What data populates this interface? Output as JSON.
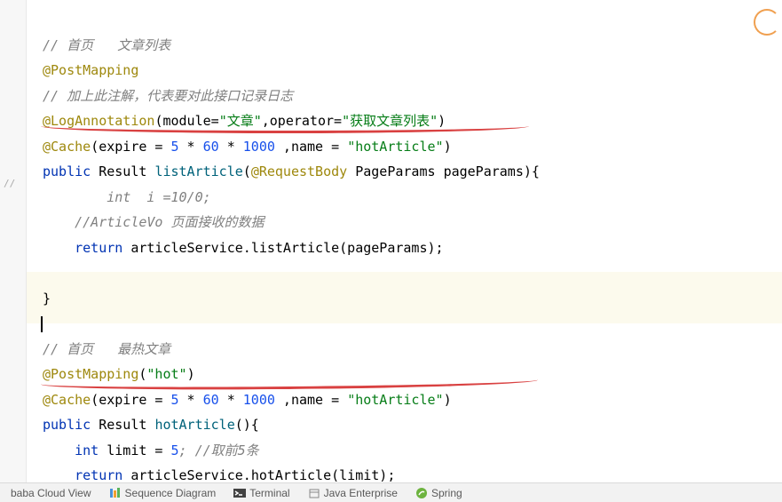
{
  "code": {
    "l1_comment": "// 首页   文章列表",
    "l2_anno": "@PostMapping",
    "l3_comment": "// 加上此注解，代表要对此接口记录日志",
    "l4_anno": "@LogAnnotation",
    "l4_module_key": "module=",
    "l4_module_val": "\"文章\"",
    "l4_op_key": "operator=",
    "l4_op_val": "\"获取文章列表\"",
    "l5_anno": "@Cache",
    "l5_exp_key": "expire = ",
    "l5_n1": "5",
    "l5_n2": "60",
    "l5_n3": "1000",
    "l5_name_key": " ,name = ",
    "l5_name_val": "\"hotArticle\"",
    "l6_kw1": "public",
    "l6_type": "Result",
    "l6_method": "listArticle",
    "l6_anno": "@RequestBody",
    "l6_ptype": "PageParams",
    "l6_pname": "pageParams",
    "l7_comment": "        int  i =10/0;",
    "l8_comment": "    //ArticleVo 页面接收的数据",
    "l9_kw": "return",
    "l9_obj": "articleService",
    "l9_call": "listArticle(pageParams);",
    "l11_brace": "}",
    "l13_comment": "// 首页   最热文章",
    "l14_anno": "@PostMapping",
    "l14_arg": "\"hot\"",
    "l15_anno": "@Cache",
    "l15_exp_key": "expire = ",
    "l15_n1": "5",
    "l15_n2": "60",
    "l15_n3": "1000",
    "l15_name_key": " ,name = ",
    "l15_name_val": "\"hotArticle\"",
    "l16_kw1": "public",
    "l16_type": "Result",
    "l16_method": "hotArticle",
    "l17_kw": "int",
    "l17_var": "limit = ",
    "l17_n": "5",
    "l17_comment": "; //取前5条",
    "l18_kw": "return",
    "l18_obj": "articleService",
    "l18_call": "hotArticle(limit);",
    "l19_brace": "}"
  },
  "statusbar": {
    "cloud": "baba Cloud View",
    "seq": "Sequence Diagram",
    "term": "Terminal",
    "java": "Java Enterprise",
    "spring": "Spring"
  },
  "gutter_mark": "//"
}
